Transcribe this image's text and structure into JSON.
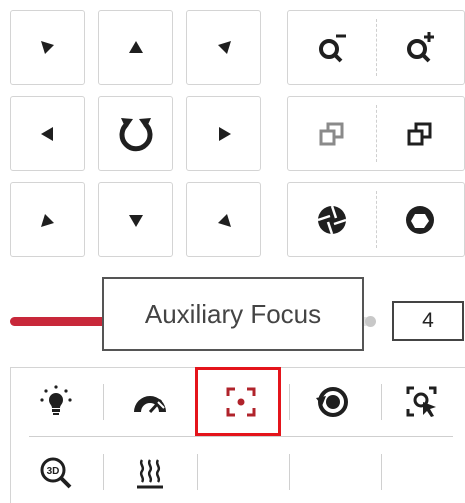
{
  "ptz": {
    "directions": [
      {
        "name": "pan-up-left",
        "icon": "arrow-up-left-icon"
      },
      {
        "name": "pan-up",
        "icon": "arrow-up-icon"
      },
      {
        "name": "pan-up-right",
        "icon": "arrow-up-right-icon"
      },
      {
        "name": "pan-left",
        "icon": "arrow-left-icon"
      },
      {
        "name": "auto-rotate",
        "icon": "auto-rotate-icon"
      },
      {
        "name": "pan-right",
        "icon": "arrow-right-icon"
      },
      {
        "name": "pan-down-left",
        "icon": "arrow-down-left-icon"
      },
      {
        "name": "pan-down",
        "icon": "arrow-down-icon"
      },
      {
        "name": "pan-down-right",
        "icon": "arrow-down-right-icon"
      }
    ],
    "lens_controls": [
      {
        "left": "zoom-out-icon",
        "right": "zoom-in-icon"
      },
      {
        "left": "focus-near-icon",
        "right": "focus-far-icon"
      },
      {
        "left": "iris-close-icon",
        "right": "iris-open-icon"
      }
    ]
  },
  "speed": {
    "value": "4",
    "level_fraction": 0.27
  },
  "tooltip": {
    "text": "Auxiliary Focus"
  },
  "toolbar": {
    "row1": [
      "light-icon",
      "wiper-icon",
      "auxiliary-focus-icon",
      "lens-initialization-icon",
      "manual-tracking-icon"
    ],
    "row2": [
      "3d-zoom-icon",
      "heater-icon"
    ],
    "selected": "auxiliary-focus-icon"
  },
  "colors": {
    "accent": "#c8283a",
    "selected_outline": "#e4141b",
    "icon": "#1f1f1f"
  }
}
